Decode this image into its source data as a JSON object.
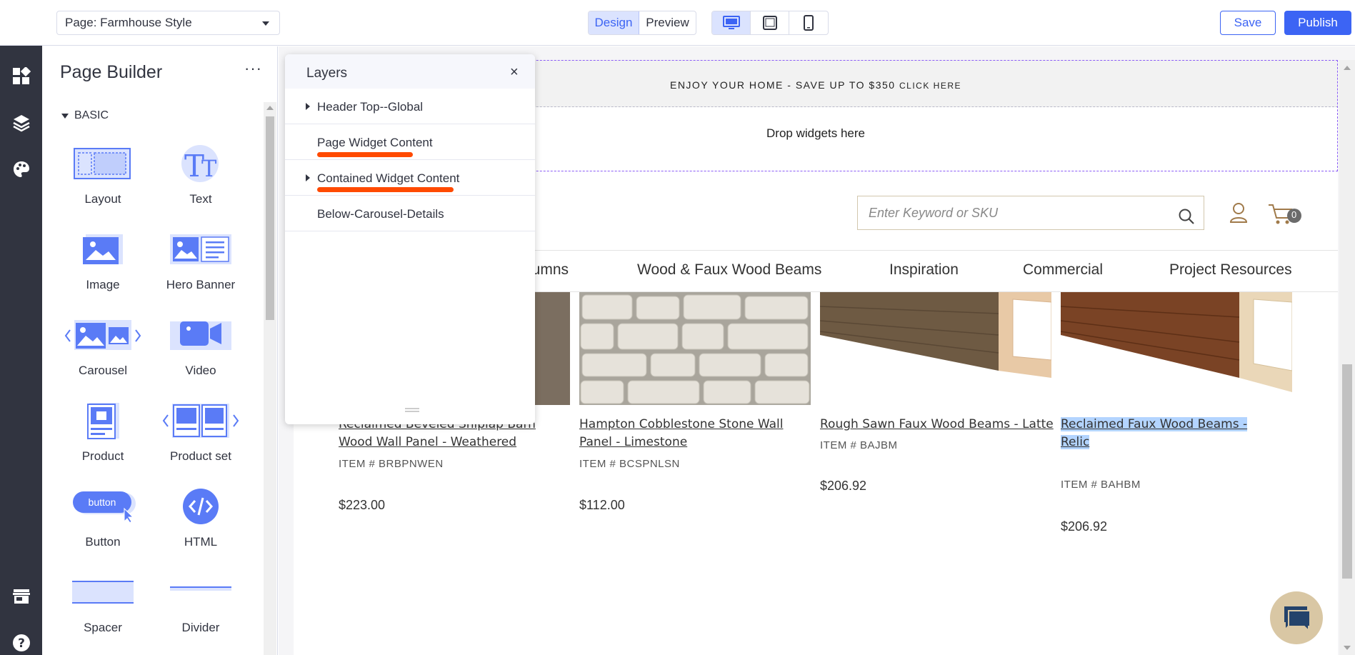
{
  "topbar": {
    "page_selector": "Page: Farmhouse Style",
    "design_label": "Design",
    "preview_label": "Preview",
    "save_label": "Save",
    "publish_label": "Publish"
  },
  "page_builder": {
    "title": "Page Builder",
    "more": "···",
    "category": "BASIC",
    "widgets": [
      {
        "label": "Layout",
        "icon": "layout-icon"
      },
      {
        "label": "Text",
        "icon": "text-icon"
      },
      {
        "label": "Image",
        "icon": "image-icon"
      },
      {
        "label": "Hero Banner",
        "icon": "hero-banner-icon"
      },
      {
        "label": "Carousel",
        "icon": "carousel-icon"
      },
      {
        "label": "Video",
        "icon": "video-icon"
      },
      {
        "label": "Product",
        "icon": "product-icon"
      },
      {
        "label": "Product set",
        "icon": "product-set-icon"
      },
      {
        "label": "Button",
        "icon": "button-icon"
      },
      {
        "label": "HTML",
        "icon": "html-icon"
      },
      {
        "label": "Spacer",
        "icon": "spacer-icon"
      },
      {
        "label": "Divider",
        "icon": "divider-icon"
      }
    ],
    "button_widget_text": "button"
  },
  "layers": {
    "title": "Layers",
    "close": "×",
    "rows": [
      {
        "label": "Header Top--Global",
        "expandable": true
      },
      {
        "label": "Page Widget Content",
        "expandable": false
      },
      {
        "label": "Contained Widget Content",
        "expandable": true
      },
      {
        "label": "Below-Carousel-Details",
        "expandable": false
      }
    ]
  },
  "store": {
    "banner_text": "ENJOY YOUR HOME - SAVE UP TO $350",
    "banner_link": "CLICK HERE",
    "drop_zone": "Drop widgets here",
    "search_placeholder": "Enter Keyword or SKU",
    "cart_count": "0",
    "nav": [
      "lumns",
      "Wood & Faux Wood Beams",
      "Inspiration",
      "Commercial",
      "Project Resources"
    ],
    "products": [
      {
        "title": "Reclaimed Beveled Shiplap Barn Wood Wall Panel - Weathered",
        "sku": "ITEM # BRBPNWEN",
        "price": "$223.00"
      },
      {
        "title": "Hampton Cobblestone Stone Wall Panel - Limestone",
        "sku": "ITEM # BCSPNLSN",
        "price": "$112.00"
      },
      {
        "title": "Rough Sawn Faux Wood Beams - Latte",
        "sku": "ITEM # BAJBM",
        "price": "$206.92"
      },
      {
        "title": "Reclaimed Faux Wood Beams - Relic",
        "sku": "ITEM # BAHBM",
        "price": "$206.92"
      }
    ]
  },
  "colors": {
    "accent": "#3c64f4",
    "rail": "#313440",
    "highlight_scribble": "#ff4a00",
    "selected_text": "#b3d4ff"
  }
}
